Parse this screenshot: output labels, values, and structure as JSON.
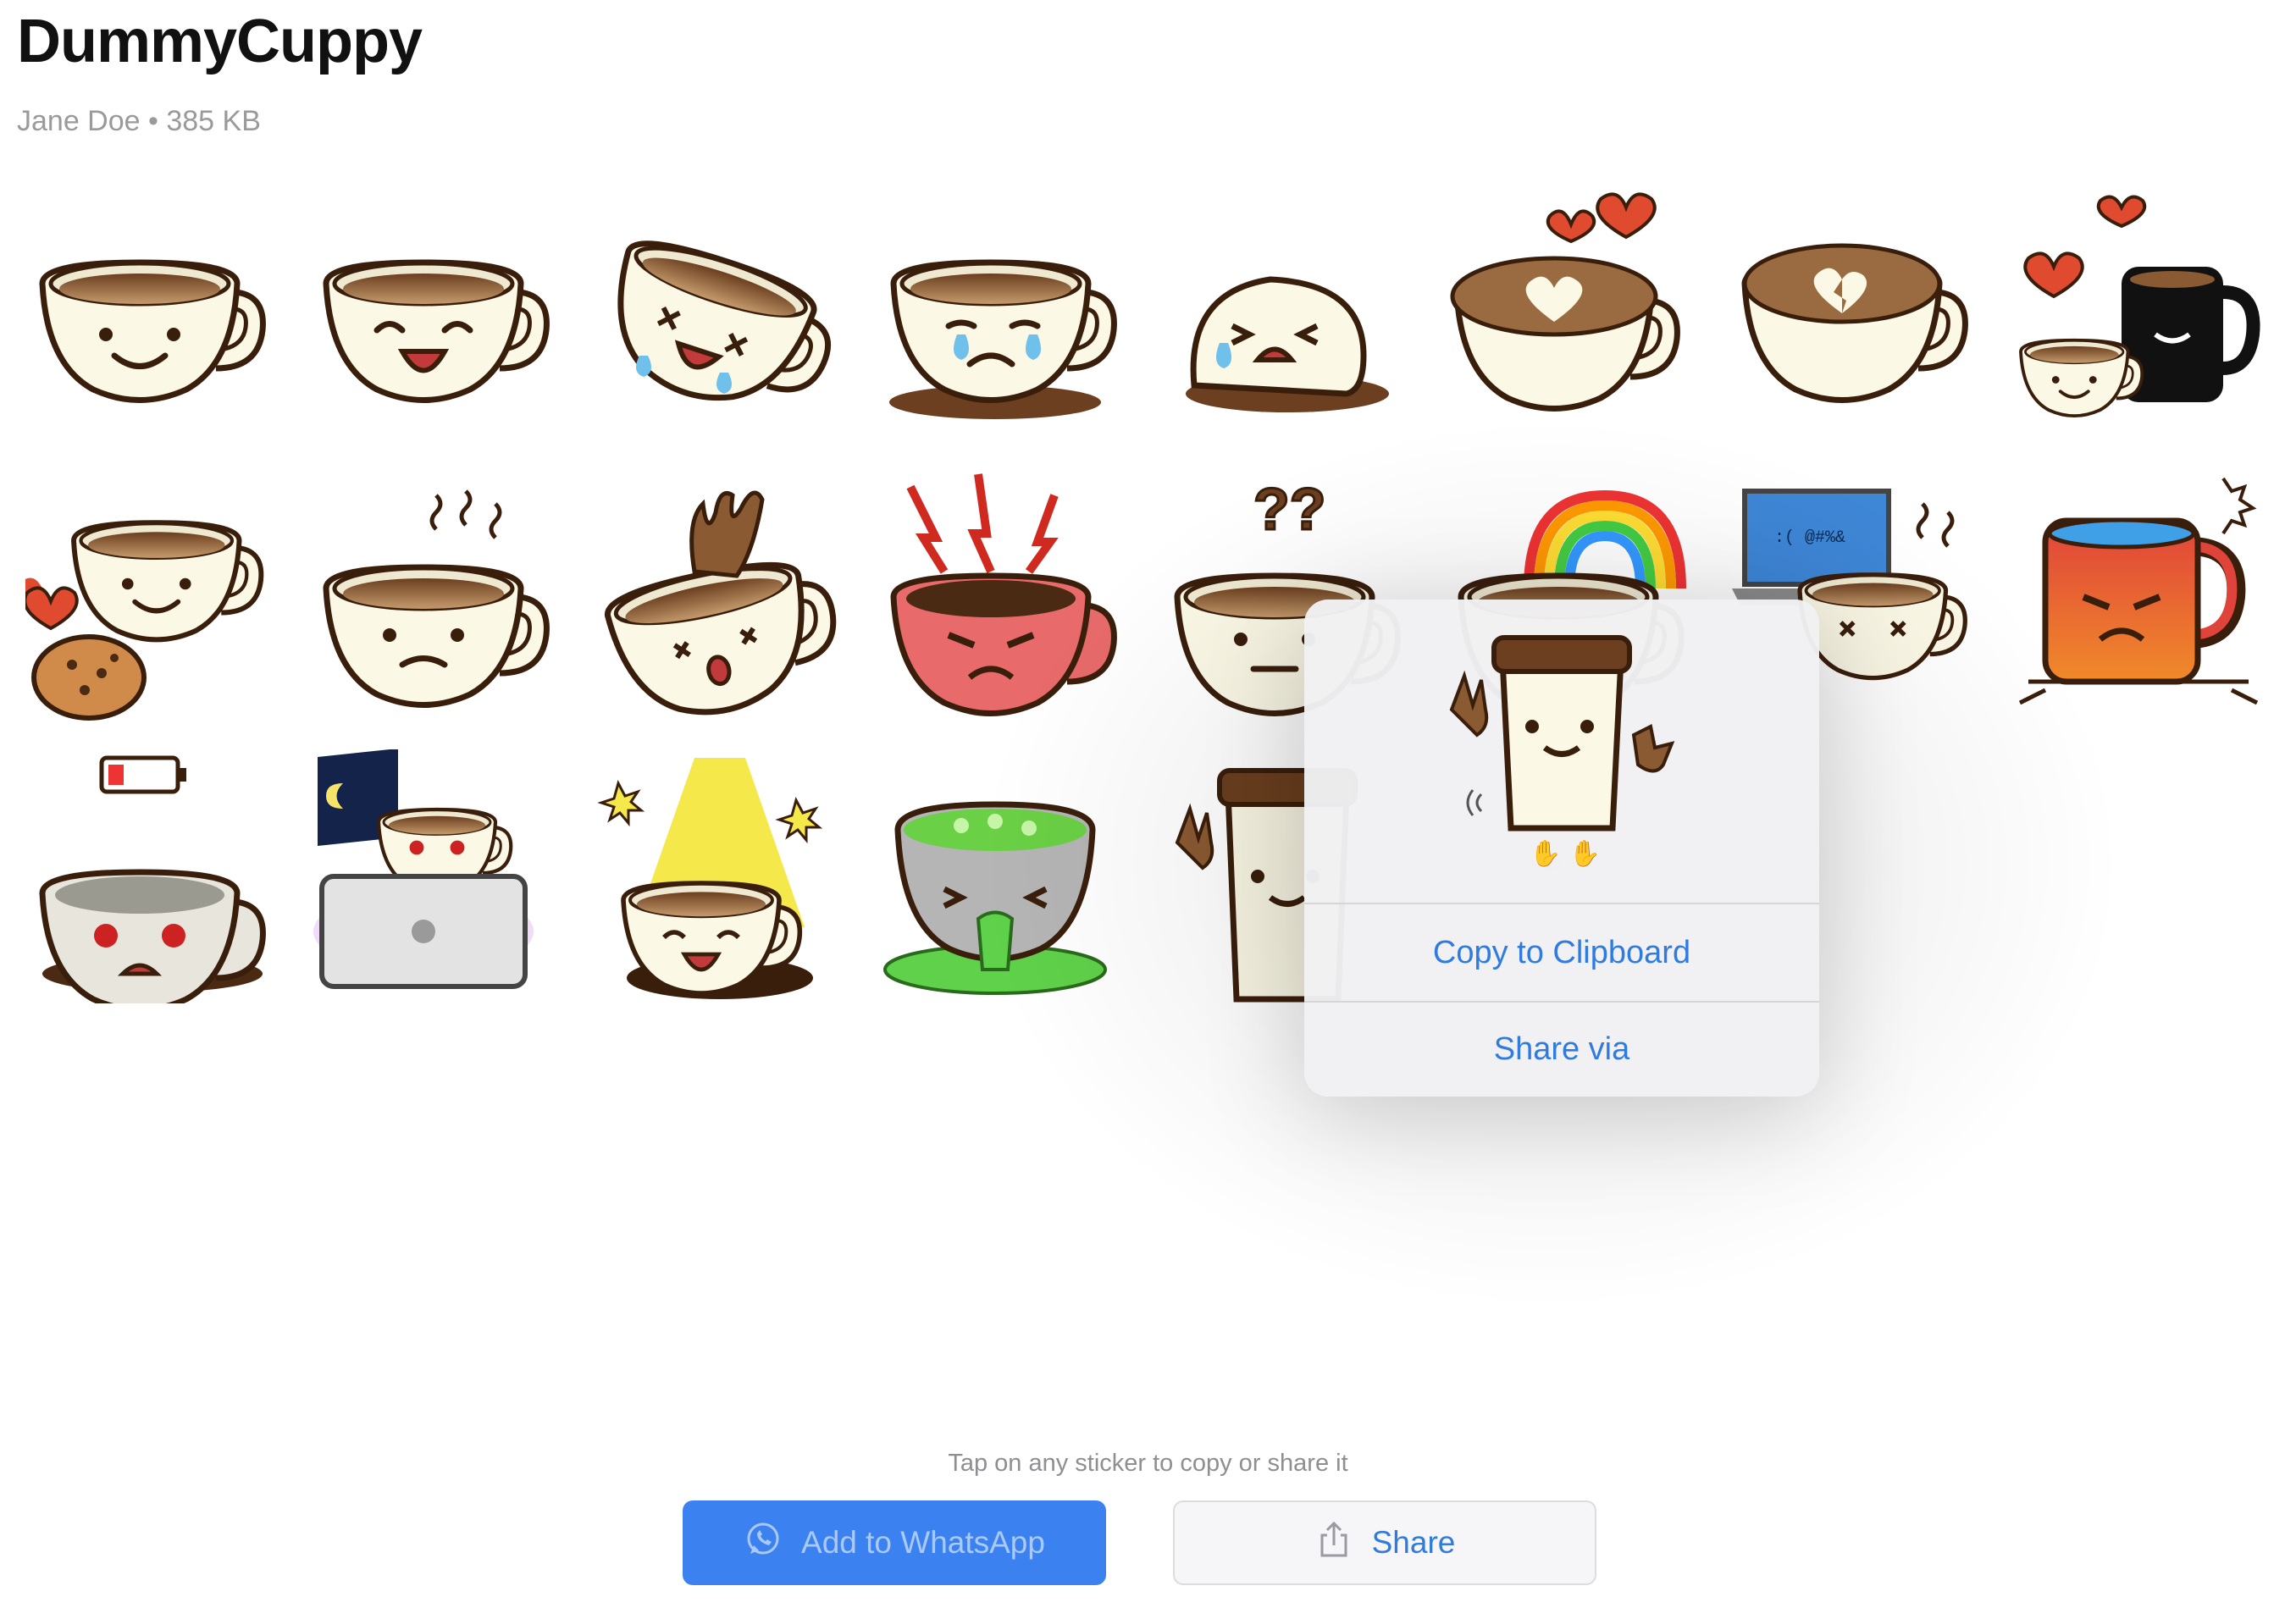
{
  "pack": {
    "title": "DummyCuppy",
    "publisher": "Jane Doe",
    "size": "385 KB",
    "separator": " • "
  },
  "stickers": [
    {
      "name": "happy-cup"
    },
    {
      "name": "laughing-cup"
    },
    {
      "name": "tipped-laughing-cup"
    },
    {
      "name": "crying-cup"
    },
    {
      "name": "spilled-crying-cup"
    },
    {
      "name": "heart-latte"
    },
    {
      "name": "broken-heart-latte"
    },
    {
      "name": "love-mugs"
    },
    {
      "name": "latte-cookie"
    },
    {
      "name": "steaming-sad-cup"
    },
    {
      "name": "splashing-cup"
    },
    {
      "name": "angry-red-cup"
    },
    {
      "name": "confused-cup"
    },
    {
      "name": "rainbow-cup"
    },
    {
      "name": "laptop-cup"
    },
    {
      "name": "angry-red-mug"
    },
    {
      "name": "low-battery-cup"
    },
    {
      "name": "night-laptop-cup"
    },
    {
      "name": "spotlight-cup"
    },
    {
      "name": "sick-green-cup"
    },
    {
      "name": "waving-paper-cup"
    }
  ],
  "context_menu": {
    "preview_sticker": "waving-paper-cup",
    "copy_label": "Copy to Clipboard",
    "share_label": "Share via"
  },
  "hint": "Tap on any sticker to copy or share it",
  "buttons": {
    "add_label": "Add to WhatsApp",
    "share_label": "Share"
  },
  "colors": {
    "accent_blue": "#3b82f0",
    "link_blue": "#2f7be0",
    "cup_cream": "#fbf8e6",
    "coffee_brown": "#8a5a32",
    "outline": "#3a1e0c"
  },
  "icons": [
    "whatsapp-icon",
    "share-icon"
  ]
}
